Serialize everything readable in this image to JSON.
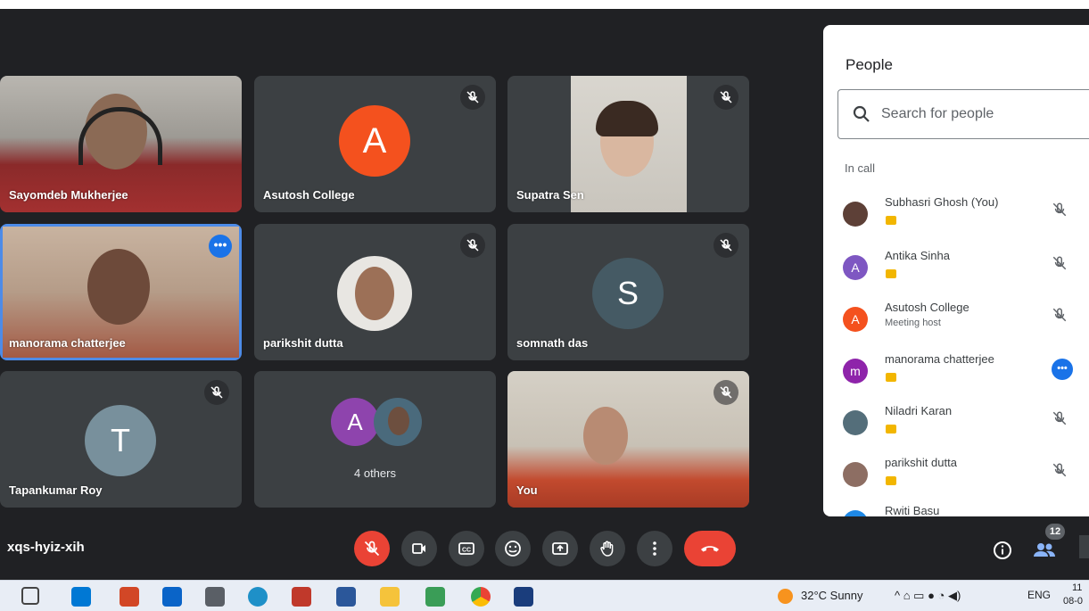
{
  "tiles": {
    "t1": {
      "name": "Sayomdeb Mukherjee"
    },
    "t2": {
      "name": "Asutosh College",
      "initial": "A"
    },
    "t3": {
      "name": "Supatra Sen"
    },
    "t4": {
      "name": "manorama chatterjee"
    },
    "t5": {
      "name": "parikshit dutta"
    },
    "t6": {
      "name": "somnath das",
      "initial": "S"
    },
    "t7": {
      "name": "Tapankumar Roy",
      "initial": "T"
    },
    "t8": {
      "label": "4 others",
      "initial": "A"
    },
    "t9": {
      "name": "You"
    }
  },
  "people_panel": {
    "title": "People",
    "search_placeholder": "Search for people",
    "section_label": "In call",
    "participants": [
      {
        "name": "Subhasri Ghosh (You)"
      },
      {
        "name": "Antika Sinha",
        "initial": "A"
      },
      {
        "name": "Asutosh College",
        "initial": "A",
        "role": "Meeting host"
      },
      {
        "name": "manorama chatterjee",
        "initial": "m"
      },
      {
        "name": "Niladri Karan"
      },
      {
        "name": "parikshit dutta"
      },
      {
        "name": "Rwiti Basu",
        "initial": "R"
      }
    ]
  },
  "meeting": {
    "code": "xqs-hyiz-xih",
    "people_count": "12"
  },
  "colors": {
    "end_call": "#ea4335",
    "mic_off": "#ea4335",
    "accent": "#1a73e8"
  },
  "taskbar": {
    "weather": "32°C  Sunny",
    "language": "ENG",
    "time": "11",
    "date": "08-0"
  }
}
